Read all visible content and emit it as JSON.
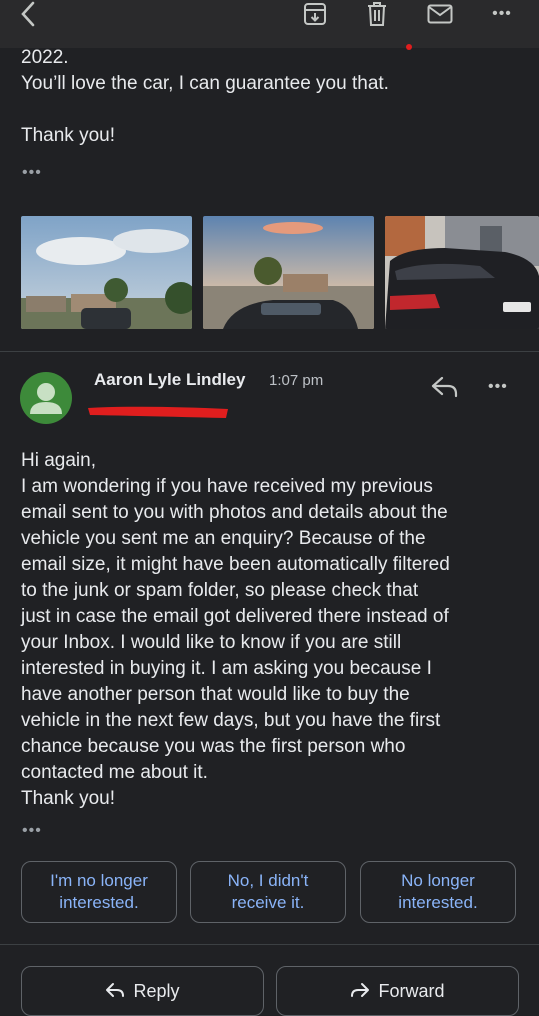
{
  "topbar": {
    "icons": [
      "back-icon",
      "archive-icon",
      "trash-icon",
      "mail-icon",
      "more-icon"
    ]
  },
  "previous_message": {
    "line1": "2022.",
    "line2": "You’ll love the car, I can guarantee you that.",
    "line3": "Thank you!",
    "more": "•••"
  },
  "message": {
    "sender": "Aaron Lyle Lindley",
    "time": "1:07 pm",
    "more": "•••",
    "body_lines": [
      "Hi again,",
      "I am wondering if you have received my previous",
      "email sent to you with photos and details about the",
      "vehicle you sent me an enquiry? Because of the",
      "email size, it might have been automatically filtered",
      "to the junk or spam folder, so please check that",
      "just in case the email got delivered there instead of",
      "your Inbox. I would like to know if you are still",
      "interested in buying it. I am asking you because I",
      "have another person that would like to buy the",
      "vehicle in the next few days, but you have the first",
      "chance because you was the first person who",
      "contacted me about it.",
      "Thank you!"
    ],
    "trim": "•••"
  },
  "smart_replies": [
    {
      "line1": "I'm no longer",
      "line2": "interested."
    },
    {
      "line1": "No, I didn't",
      "line2": "receive it."
    },
    {
      "line1": "No longer",
      "line2": "interested."
    }
  ],
  "actions": {
    "reply": "Reply",
    "forward": "Forward"
  },
  "colors": {
    "background": "#202124",
    "accent": "#8ab4f8",
    "avatar": "#3d8a3a",
    "redaction": "#e01e1e"
  }
}
